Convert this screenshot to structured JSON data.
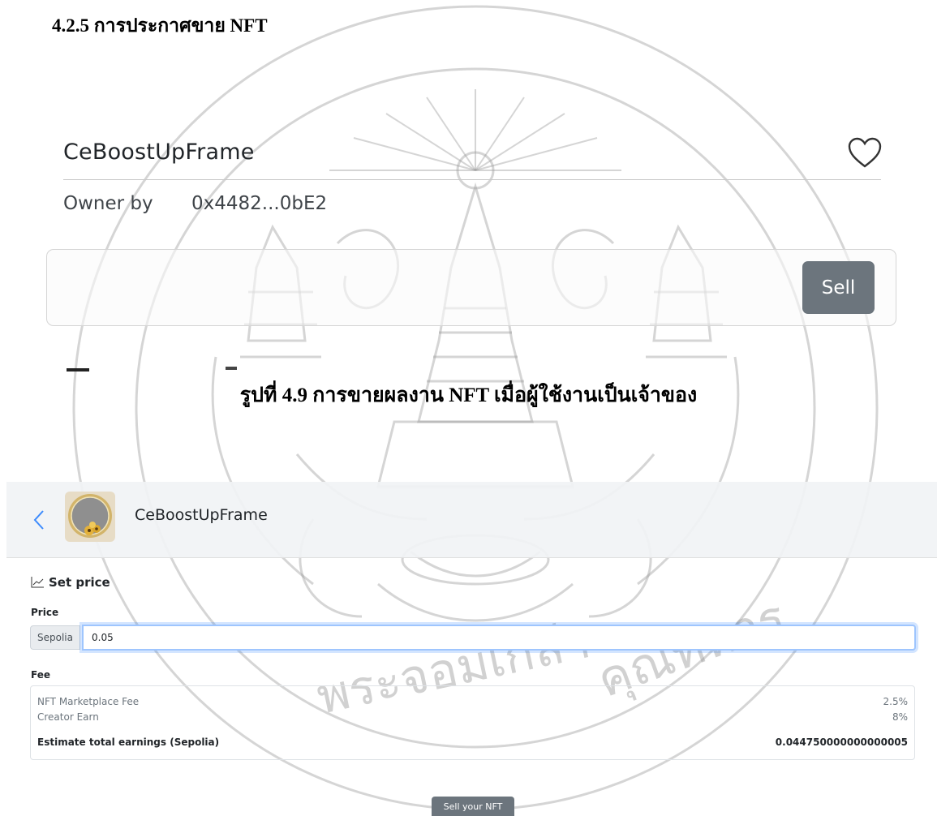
{
  "document": {
    "section_heading": "4.2.5 การประกาศขาย NFT",
    "figure_caption": "รูปที่ 4.9 การขายผลงาน NFT เมื่อผู้ใช้งานเป็นเจ้าของ"
  },
  "nft_card": {
    "title": "CeBoostUpFrame",
    "owner_label": "Owner by",
    "owner_address": "0x4482...0bE2",
    "sell_button": "Sell",
    "favorite_icon": "heart-icon"
  },
  "sell_page": {
    "back_icon": "chevron-left-icon",
    "nft_name": "CeBoostUpFrame",
    "set_price_heading": "Set price",
    "set_price_icon": "line-chart-icon",
    "price_label": "Price",
    "currency": "Sepolia",
    "price_value": "0.05",
    "fee_label": "Fee",
    "fees": [
      {
        "label": "NFT Marketplace Fee",
        "value": "2.5%"
      },
      {
        "label": "Creator Earn",
        "value": "8%"
      }
    ],
    "total": {
      "label": "Estimate total earnings (Sepolia)",
      "value": "0.044750000000000005"
    },
    "submit_button": "Sell your NFT"
  },
  "colors": {
    "secondary_button": "#6c757d",
    "input_focus_border": "#9ec5fe",
    "topbar_bg": "#f1f3f5",
    "watermark": "#b0b0b0"
  }
}
